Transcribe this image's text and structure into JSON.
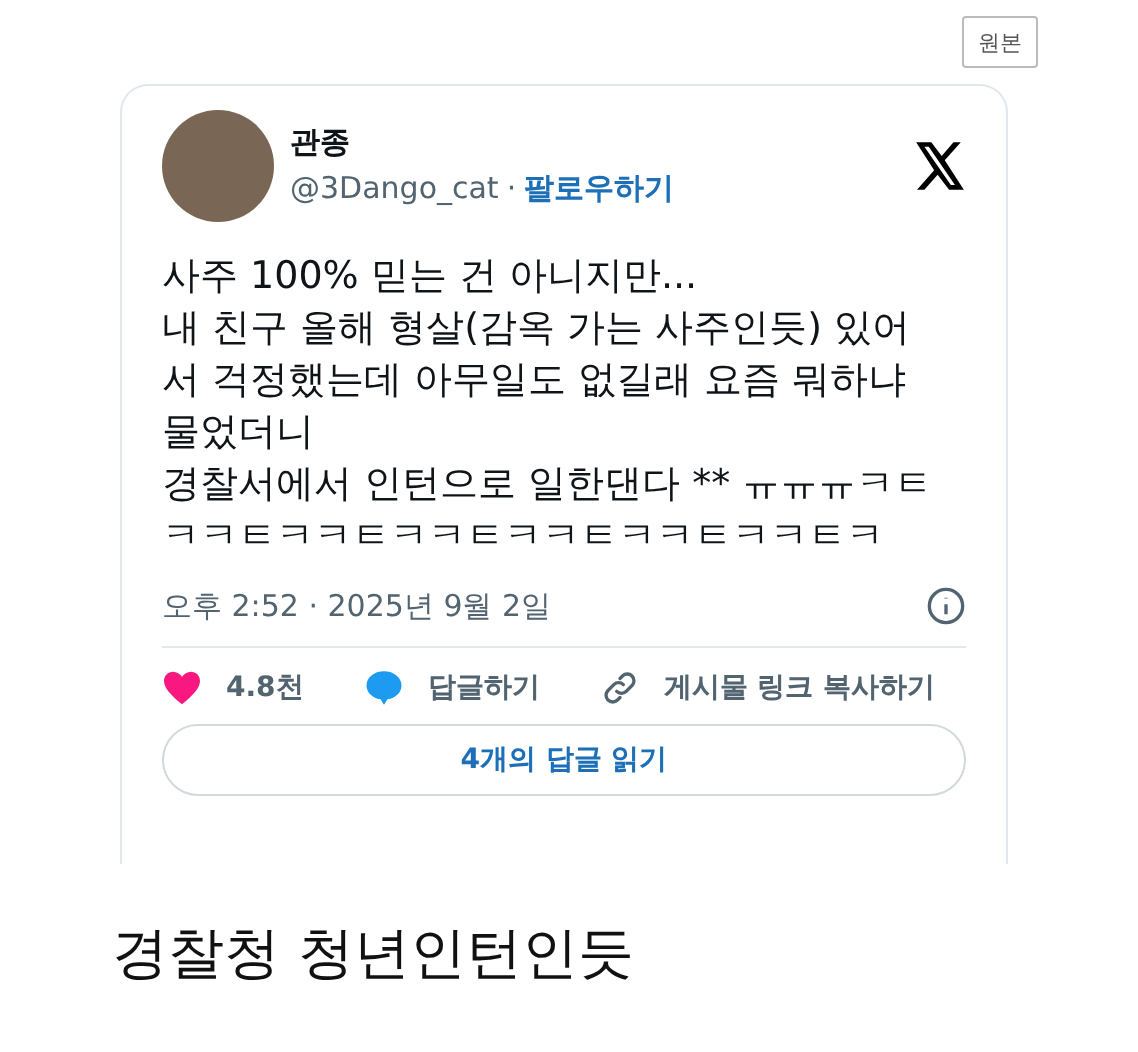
{
  "original_button": "원본",
  "tweet": {
    "name": "관종",
    "handle": "@3Dango_cat",
    "separator": "·",
    "follow": "팔로우하기",
    "lines": [
      "사주 100% 믿는 건 아니지만...",
      "내 친구 올해 형살(감옥 가는 사주인듯) 있어",
      "서 걱정했는데 아무일도 없길래 요즘 뭐하냐",
      "물었더니",
      "경찰서에서 인턴으로 일한댄다 ** ㅠㅠㅠㅋㅌ",
      "ㅋㅋㅌㅋㅋㅌㅋㅋㅌㅋㅋㅌㅋㅋㅌㅋㅋㅌㅋ"
    ],
    "timestamp": "오후 2:52 · 2025년 9월 2일",
    "actions": [
      {
        "kind": "like",
        "label": "4.8천"
      },
      {
        "kind": "reply",
        "label": "답글하기"
      },
      {
        "kind": "link",
        "label": "게시물 링크 복사하기"
      }
    ],
    "read_replies": "4개의 답글 읽기"
  },
  "caption": "경찰청 청년인턴인듯"
}
